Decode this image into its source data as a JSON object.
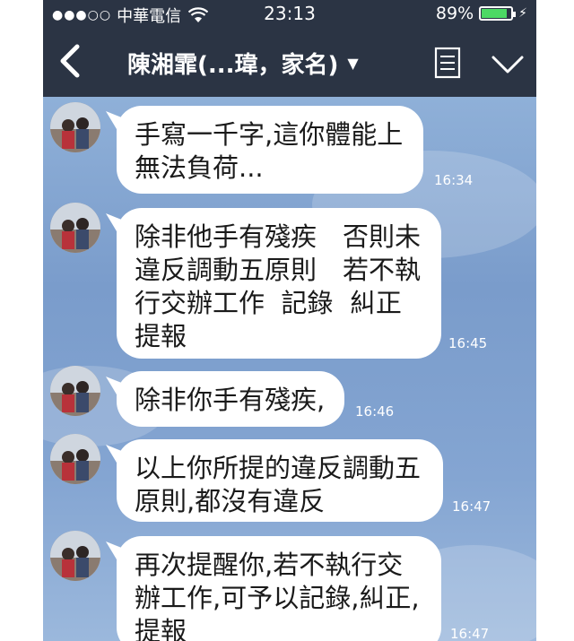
{
  "status_bar": {
    "signal": "●●●○○",
    "carrier": "中華電信",
    "time": "23:13",
    "battery_percent": "89%",
    "battery_level": 0.89
  },
  "header": {
    "back_icon": "chevron-left-icon",
    "title": "陳湘霏(...瑋，家名)",
    "dropdown_icon": "caret-down-icon",
    "notes_icon": "notes-icon",
    "collapse_icon": "chevron-down-icon"
  },
  "messages": [
    {
      "text": "手寫一千字,這你體能上\n無法負荷...",
      "time": "16:34"
    },
    {
      "text": "除非他手有殘疾　否則未\n違反調動五原則　若不執\n行交辦工作  記錄  糾正\n提報",
      "time": "16:45"
    },
    {
      "text": "除非你手有殘疾,",
      "time": "16:46"
    },
    {
      "text": "以上你所提的違反調動五\n原則,都沒有違反",
      "time": "16:47"
    },
    {
      "text": "再次提醒你,若不執行交\n辦工作,可予以記錄,糾正,\n提報",
      "time": "16:47"
    }
  ]
}
